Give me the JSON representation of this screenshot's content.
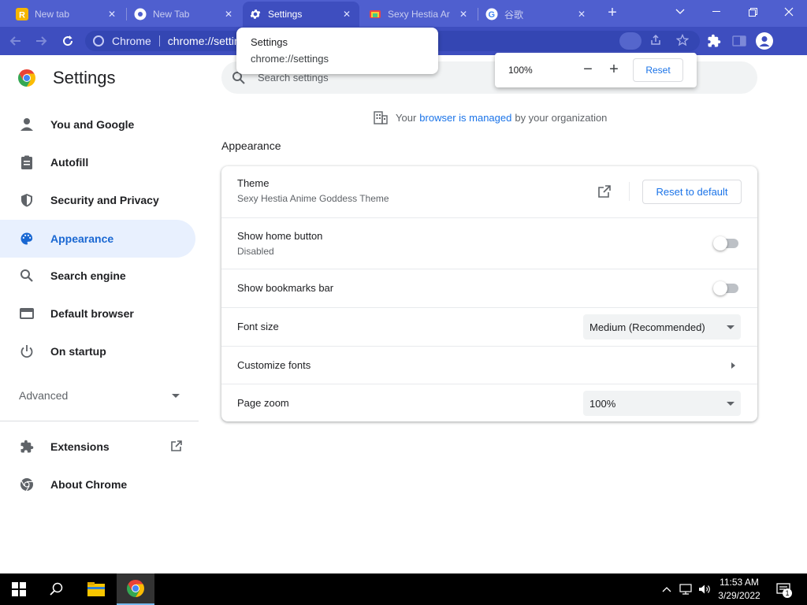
{
  "tabs": [
    {
      "title": "New tab",
      "active": false
    },
    {
      "title": "New Tab",
      "active": false
    },
    {
      "title": "Settings",
      "active": true
    },
    {
      "title": "Sexy Hestia Ar",
      "active": false
    },
    {
      "title": "谷歌",
      "active": false
    }
  ],
  "toolbar": {
    "omnibox_brand": "Chrome",
    "omnibox_url": "chrome://settin"
  },
  "hover_card": {
    "title": "Settings",
    "url": "chrome://settings"
  },
  "zoom_bubble": {
    "level": "100%",
    "minus": "−",
    "plus": "+",
    "reset_label": "Reset"
  },
  "header": {
    "title": "Settings",
    "search_placeholder": "Search settings"
  },
  "sidebar": {
    "items": [
      {
        "label": "You and Google",
        "icon": "person-icon"
      },
      {
        "label": "Autofill",
        "icon": "clipboard-icon"
      },
      {
        "label": "Security and Privacy",
        "icon": "shield-icon"
      },
      {
        "label": "Appearance",
        "icon": "palette-icon",
        "selected": true
      },
      {
        "label": "Search engine",
        "icon": "search-icon"
      },
      {
        "label": "Default browser",
        "icon": "browser-icon"
      },
      {
        "label": "On startup",
        "icon": "power-icon"
      }
    ],
    "advanced": "Advanced",
    "extensions": "Extensions",
    "about": "About Chrome"
  },
  "managed": {
    "prefix": "Your",
    "link": "browser is managed",
    "suffix": "by your organization"
  },
  "appearance": {
    "section_title": "Appearance",
    "theme_label": "Theme",
    "theme_value": "Sexy Hestia Anime Goddess Theme",
    "reset_default": "Reset to default",
    "home_button_label": "Show home button",
    "home_button_sub": "Disabled",
    "bookmarks_bar_label": "Show bookmarks bar",
    "font_size_label": "Font size",
    "font_size_value": "Medium (Recommended)",
    "customize_fonts_label": "Customize fonts",
    "page_zoom_label": "Page zoom",
    "page_zoom_value": "100%"
  },
  "taskbar": {
    "time": "11:53 AM",
    "date": "3/29/2022",
    "notification_count": "1"
  },
  "colors": {
    "frame": "#4f5fcf",
    "toolbar": "#3e4ebf",
    "accent": "#1a73e8",
    "selected_nav_bg": "#e8f0fe"
  }
}
